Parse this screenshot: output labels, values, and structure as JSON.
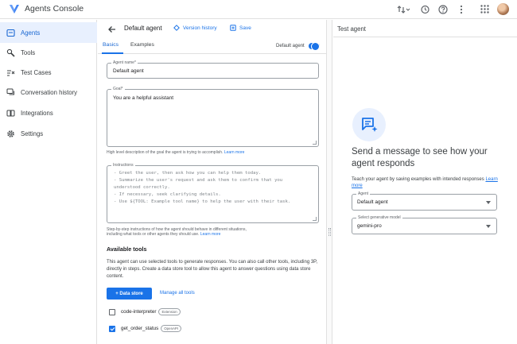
{
  "app": {
    "title": "Agents Console"
  },
  "sidebar": {
    "items": [
      {
        "label": "Agents",
        "icon": "agents-icon",
        "active": true
      },
      {
        "label": "Tools",
        "icon": "tools-icon"
      },
      {
        "label": "Test Cases",
        "icon": "test-cases-icon"
      },
      {
        "label": "Conversation history",
        "icon": "conversation-history-icon"
      },
      {
        "label": "Integrations",
        "icon": "integrations-icon"
      },
      {
        "label": "Settings",
        "icon": "gear-icon"
      }
    ]
  },
  "editor": {
    "title": "Default agent",
    "version_history_label": "Version history",
    "save_label": "Save",
    "tabs": [
      {
        "label": "Basics",
        "active": true
      },
      {
        "label": "Examples"
      }
    ],
    "default_agent_toggle": {
      "label": "Default agent",
      "on": true
    },
    "agent_name": {
      "label": "Agent name*",
      "value": "Default agent"
    },
    "goal": {
      "label": "Goal*",
      "value": "You are a helpful assistant",
      "helper": "High level description of the goal the agent is trying to accomplish.",
      "learn_more": "Learn more"
    },
    "instructions": {
      "label": "Instructions",
      "lines": [
        "- Greet the user, then ask how you can help them today.",
        "- Summarize the user's request and ask them to confirm that you",
        "  understood correctly.",
        "- If necessary, seek clarifying details.",
        "- Use ${TOOL: Example tool name} to help the user with their task."
      ],
      "helper_line1": "Step-by-step instructions of how the agent should behave in different situations,",
      "helper_line2": "including what tools or other agents they should use.",
      "learn_more": "Learn more"
    },
    "available_tools": {
      "title": "Available tools",
      "description": "This agent can use selected tools to generate responses. You can also call other tools, including 3P, directly in steps. Create a data store tool to allow this agent to answer questions using data store content.",
      "data_store_button": "+ Data store",
      "manage_link": "Manage all tools",
      "tools": [
        {
          "name": "code-interpreter",
          "badge": "Extension",
          "checked": false
        },
        {
          "name": "get_order_status",
          "badge": "OpenAPI",
          "checked": true
        }
      ]
    }
  },
  "test_panel": {
    "title": "Test agent",
    "heading": "Send a message to see how your agent responds",
    "description": "Teach your agent by saving examples with intended responses",
    "learn_more": "Learn more",
    "agent_select": {
      "label": "Agent",
      "value": "Default agent"
    },
    "model_select": {
      "label": "Select generative model",
      "value": "gemini-pro"
    }
  },
  "colors": {
    "accent": "#1a73e8",
    "active_bg": "#e8f0fe"
  }
}
